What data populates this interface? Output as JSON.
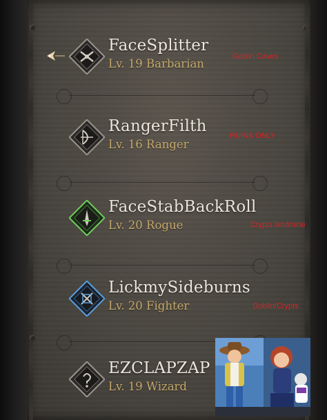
{
  "characters": [
    {
      "name": "FaceSplitter",
      "level": "Lv. 19 Barbarian",
      "note": "Goblin Caves",
      "emblem_icon": "barbarian-class-icon",
      "accent": "#cfcac0",
      "selected": true
    },
    {
      "name": "RangerFilth",
      "level": "Lv. 16 Ranger",
      "note": "RUINS ONLY",
      "emblem_icon": "ranger-class-icon",
      "accent": "#cfcac0",
      "selected": false
    },
    {
      "name": "FaceStabBackRoll",
      "level": "Lv. 20 Rogue",
      "note": "Crypts landmine",
      "emblem_icon": "rogue-class-icon",
      "accent": "#6fcf5a",
      "selected": false
    },
    {
      "name": "LickmySideburns",
      "level": "Lv. 20 Fighter",
      "note": "Goblin/Crypts",
      "emblem_icon": "fighter-class-icon",
      "accent": "#5a9fdc",
      "selected": false
    },
    {
      "name": "EZCLAPZAP",
      "level": "Lv. 19 Wizard",
      "note": "",
      "emblem_icon": "wizard-class-icon",
      "accent": "#cfcac0",
      "selected": false
    }
  ],
  "colors": {
    "name_text": "#ece7dc",
    "level_text": "#c6a96c",
    "note_text": "#e02020",
    "panel": "#4a4640"
  },
  "overlay_photo": {
    "icon": "cartoon-characters-photo"
  }
}
